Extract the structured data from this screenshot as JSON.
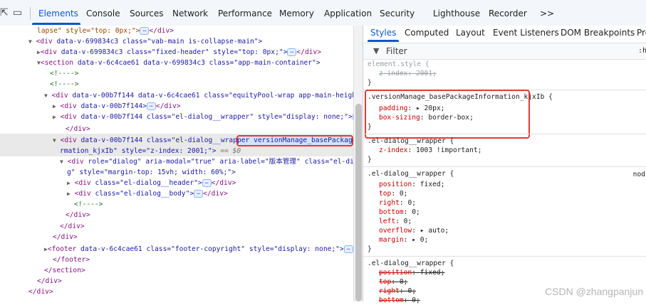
{
  "toolbar": {
    "icons": [
      "inspect-icon",
      "device-toolbar-icon"
    ],
    "tabs": [
      {
        "label": "Elements",
        "active": true
      },
      {
        "label": "Console"
      },
      {
        "label": "Sources"
      },
      {
        "label": "Network"
      },
      {
        "label": "Performance"
      },
      {
        "label": "Memory"
      },
      {
        "label": "Application"
      },
      {
        "label": "Security"
      },
      {
        "label": "Lighthouse"
      },
      {
        "label": "Recorder"
      }
    ],
    "more_label": ">>"
  },
  "elements": {
    "lines": [
      {
        "pre": "lapse\" style=\"top: 0px;\">",
        "dots": true,
        "post": "</div>"
      },
      {
        "open": "<div",
        "attrs": "data-v-699834c3 class=\"vab-main is-collapse-main\">"
      },
      {
        "open": "<div",
        "attrs": "data-v-699834c3 class=\"fixed-header\" style=\"top: 0px;\">",
        "dots": true,
        "post": "</div>"
      },
      {
        "open": "<section",
        "attrs": "data-v-6c4cae61 data-v-699834c3 class=\"app-main-container\">"
      },
      {
        "comment": "<!---->"
      },
      {
        "comment": "<!---->"
      },
      {
        "open": "<div",
        "attrs": "data-v-00b7f144 data-v-6c4cae61 class=\"equityPool-wrap app-main-height\">"
      },
      {
        "open": "<div",
        "attrs": "data-v-00b7f144>",
        "dots": true,
        "post": "</div>"
      },
      {
        "open": "<div",
        "attrs": "data-v-00b7f144 class=\"el-dialog__wrapper\" style=\"display: none;\">",
        "dots": true
      },
      {
        "close": "</div>"
      },
      {
        "open": "<div",
        "attrs": "data-v-00b7f144 class=\"el-dialog__wrapper",
        "highlight": "versionManage_basePackageInfo"
      },
      {
        "pre": "rmation_kjxIb\" style=\"z-index: 2001;\">",
        "eq": "== $0"
      },
      {
        "open": "<div",
        "attrs": "role=\"dialog\" aria-modal=\"true\" aria-label=\"版本管理\" class=\"el-dialo"
      },
      {
        "pre": "g\" style=\"margin-top: 15vh; width: 60%;\">"
      },
      {
        "open": "<div",
        "attrs": "class=\"el-dialog__header\">",
        "dots": true,
        "post": "</div>"
      },
      {
        "open": "<div",
        "attrs": "class=\"el-dialog__body\">",
        "dots": true,
        "post": "</div>"
      },
      {
        "comment": "<!---->"
      },
      {
        "close": "</div>"
      },
      {
        "close": "</div>"
      },
      {
        "close": "</div>"
      },
      {
        "open": "<footer",
        "attrs": "data-v-6c4cae61 class=\"footer-copyright\" style=\"display: none;\">",
        "dots": true
      },
      {
        "close": "</footer>"
      },
      {
        "close": "</section>"
      },
      {
        "close": "</div>"
      },
      {
        "close": "</div>"
      }
    ]
  },
  "styles_panel": {
    "tabs": [
      {
        "label": "Styles",
        "active": true
      },
      {
        "label": "Computed"
      },
      {
        "label": "Layout"
      },
      {
        "label": "Event Listeners"
      },
      {
        "label": "DOM Breakpoints"
      },
      {
        "label": "Pro"
      }
    ],
    "filter_placeholder": "Filter",
    "filter_right": ":ho",
    "rules": [
      {
        "selector": "element.style {",
        "props": [
          {
            "name": "z-index",
            "value": "2001;",
            "strike": true
          }
        ],
        "close": "}"
      },
      {
        "selector": ".versionManage_basePackageInformation_kjxIb {",
        "props": [
          {
            "name": "padding",
            "value": "▸ 20px;"
          },
          {
            "name": "box-sizing",
            "value": "border-box;"
          }
        ],
        "close": "}"
      },
      {
        "selector": ".el-dialog__wrapper {",
        "props": [
          {
            "name": "z-index",
            "value": "1003 !important;"
          }
        ],
        "close": "}"
      },
      {
        "selector": ".el-dialog__wrapper {",
        "src": "nod",
        "props": [
          {
            "name": "position",
            "value": "fixed;"
          },
          {
            "name": "top",
            "value": "0;"
          },
          {
            "name": "right",
            "value": "0;"
          },
          {
            "name": "bottom",
            "value": "0;"
          },
          {
            "name": "left",
            "value": "0;"
          },
          {
            "name": "overflow",
            "value": "▸ auto;"
          },
          {
            "name": "margin",
            "value": "▸ 0;"
          }
        ],
        "close": "}"
      },
      {
        "selector": ".el-dialog__wrapper {",
        "props": [
          {
            "name": "position",
            "value": "fixed;",
            "strike": true
          },
          {
            "name": "top",
            "value": "0;",
            "strike": true
          },
          {
            "name": "right",
            "value": "0;",
            "strike": true
          },
          {
            "name": "bottom",
            "value": "0;",
            "strike": true
          }
        ]
      }
    ]
  },
  "watermark": "CSDN @zhangpanjun"
}
